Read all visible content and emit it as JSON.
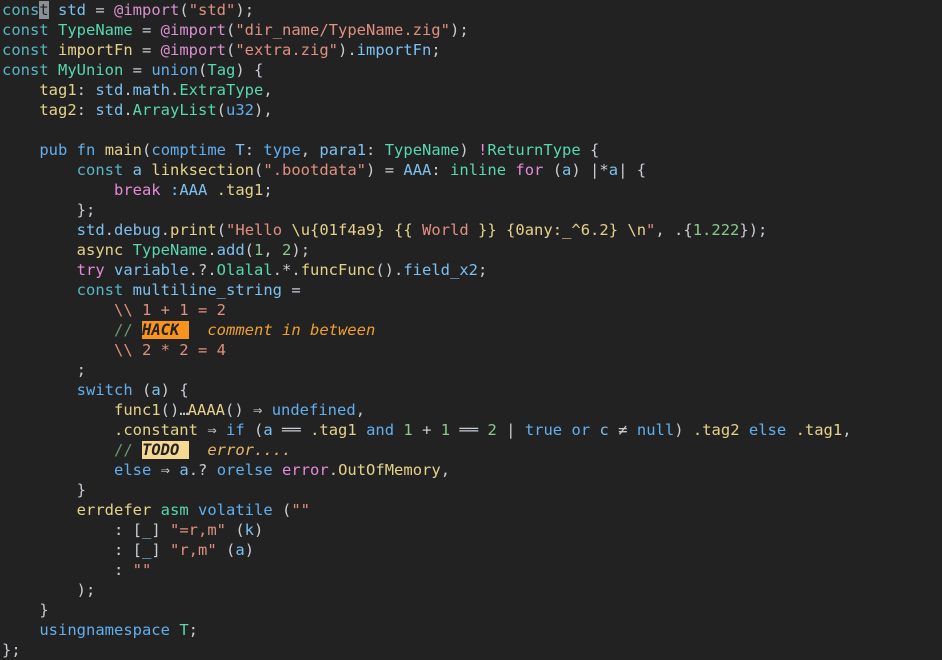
{
  "editor": {
    "name": "code-editor",
    "language": "Zig",
    "theme": "dark",
    "background_color": "#222222",
    "font": "monospace",
    "font_size_px": 15.5,
    "line_height_px": 20,
    "cursor": {
      "line": 1,
      "column": 4,
      "style": "block",
      "color": "#8a8f98",
      "over_character": "t"
    },
    "colors": {
      "background": "#222222",
      "foreground": "#c8ccd4",
      "keyword_blue": "#56b6c2",
      "keyword_pink": "#e48ad8",
      "identifier": "#7cc0f0",
      "type": "#56d8b0",
      "function": "#e5d28a",
      "field": "#e5d28a",
      "builtin": "#d98fd0",
      "string": "#e0907e",
      "escape": "#e5d28a",
      "number": "#8cc98c",
      "comment": "#6a9a6a",
      "comment_hack_text": "#f0a030",
      "comment_todo_text": "#e8b86a",
      "hack_badge_bg": "#f7931e",
      "todo_badge_bg": "#f7d794",
      "badge_fg": "#232323",
      "cursor": "#8a8f98"
    },
    "badges": {
      "hack": "HACK",
      "todo": "TODO"
    },
    "ligatures": {
      "range": "...",
      "fat_arrow": "⇒",
      "eq_eq": "══",
      "not_eq": "≠"
    }
  },
  "code": {
    "line_count": 31,
    "lines": [
      "const std = @import(\"std\");",
      "const TypeName = @import(\"dir_name/TypeName.zig\");",
      "const importFn = @import(\"extra.zig\").importFn;",
      "const MyUnion = union(Tag) {",
      "    tag1: std.math.ExtraType,",
      "    tag2: std.ArrayList(u32),",
      "",
      "    pub fn main(comptime T: type, para1: TypeName) !ReturnType {",
      "        const a linksection(\".bootdata\") = AAA: inline for (a) |*a| {",
      "            break :AAA .tag1;",
      "        };",
      "        std.debug.print(\"Hello \\u{01f4a9} {{ World }} {0any:_^6.2} \\n\", .{1.222});",
      "        async TypeName.add(1, 2);",
      "        try variable.?.Olalal.*.funcFunc().field_x2;",
      "        const multiline_string =",
      "            \\\\ 1 + 1 = 2",
      "            // HACK  comment in between",
      "            \\\\ 2 * 2 = 4",
      "        ;",
      "        switch (a) {",
      "            func1() ... AAAA() => undefined,",
      "            .constant => if (a == .tag1 and 1 + 1 == 2 | true or c != null) .tag2 else .tag1,",
      "            // TODO  error....",
      "            else => a.? orelse error.OutOfMemory,",
      "        }",
      "        errdefer asm volatile (\"\"",
      "            : [_] \"=r,m\" (k)",
      "            : [_] \"r,m\" (a)",
      "            : \"\"",
      "        );",
      "    }",
      "    usingnamespace T;",
      "};"
    ]
  }
}
